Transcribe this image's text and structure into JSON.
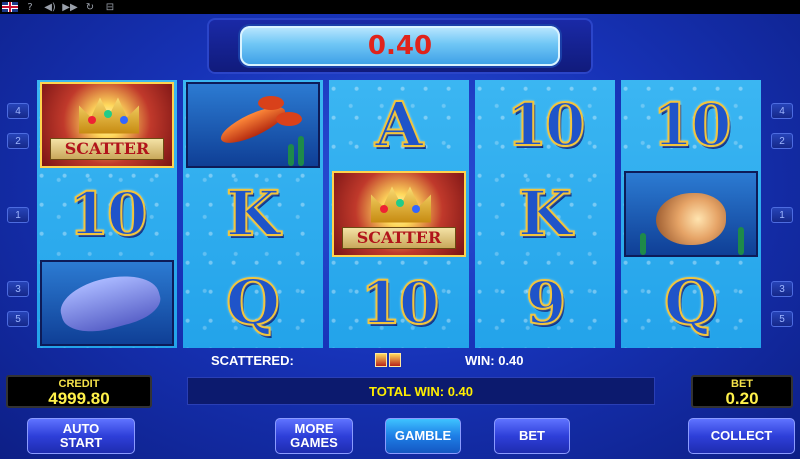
{
  "toolbar": {
    "language_icon": "uk-flag-icon",
    "help_label": "?",
    "sound_label": "◀)",
    "fast_label": "▶▶",
    "refresh_label": "↻",
    "exit_label": "⊟"
  },
  "win_display": {
    "value": "0.40"
  },
  "reels": [
    [
      {
        "type": "scatter",
        "label": "SCATTER"
      },
      {
        "type": "number",
        "label": "10"
      },
      {
        "type": "dolphin",
        "label": ""
      }
    ],
    [
      {
        "type": "lobster",
        "label": ""
      },
      {
        "type": "letter",
        "label": "K"
      },
      {
        "type": "letter",
        "label": "Q"
      }
    ],
    [
      {
        "type": "letter",
        "label": "A"
      },
      {
        "type": "scatter",
        "label": "SCATTER"
      },
      {
        "type": "number",
        "label": "10"
      }
    ],
    [
      {
        "type": "number",
        "label": "10"
      },
      {
        "type": "letter",
        "label": "K"
      },
      {
        "type": "number",
        "label": "9"
      }
    ],
    [
      {
        "type": "number",
        "label": "10"
      },
      {
        "type": "shell",
        "label": ""
      },
      {
        "type": "letter",
        "label": "Q"
      }
    ]
  ],
  "line_markers": {
    "left": [
      "4",
      "2",
      "1",
      "3",
      "5"
    ],
    "right": [
      "4",
      "2",
      "1",
      "3",
      "5"
    ]
  },
  "info": {
    "scattered_label": "SCATTERED:",
    "win_label": "WIN: 0.40",
    "total_win_label": "TOTAL WIN: 0.40"
  },
  "credit": {
    "label": "CREDIT",
    "value": "4999.80"
  },
  "bet_meter": {
    "label": "BET",
    "value": "0.20"
  },
  "buttons": {
    "auto_start": "AUTO START",
    "more_games": "MORE GAMES",
    "gamble": "GAMBLE",
    "bet": "BET",
    "collect": "COLLECT"
  },
  "colors": {
    "background": "#1733b8",
    "reel": "#23a3ea",
    "win_value": "#e0231b",
    "total_win": "#ffee00"
  }
}
